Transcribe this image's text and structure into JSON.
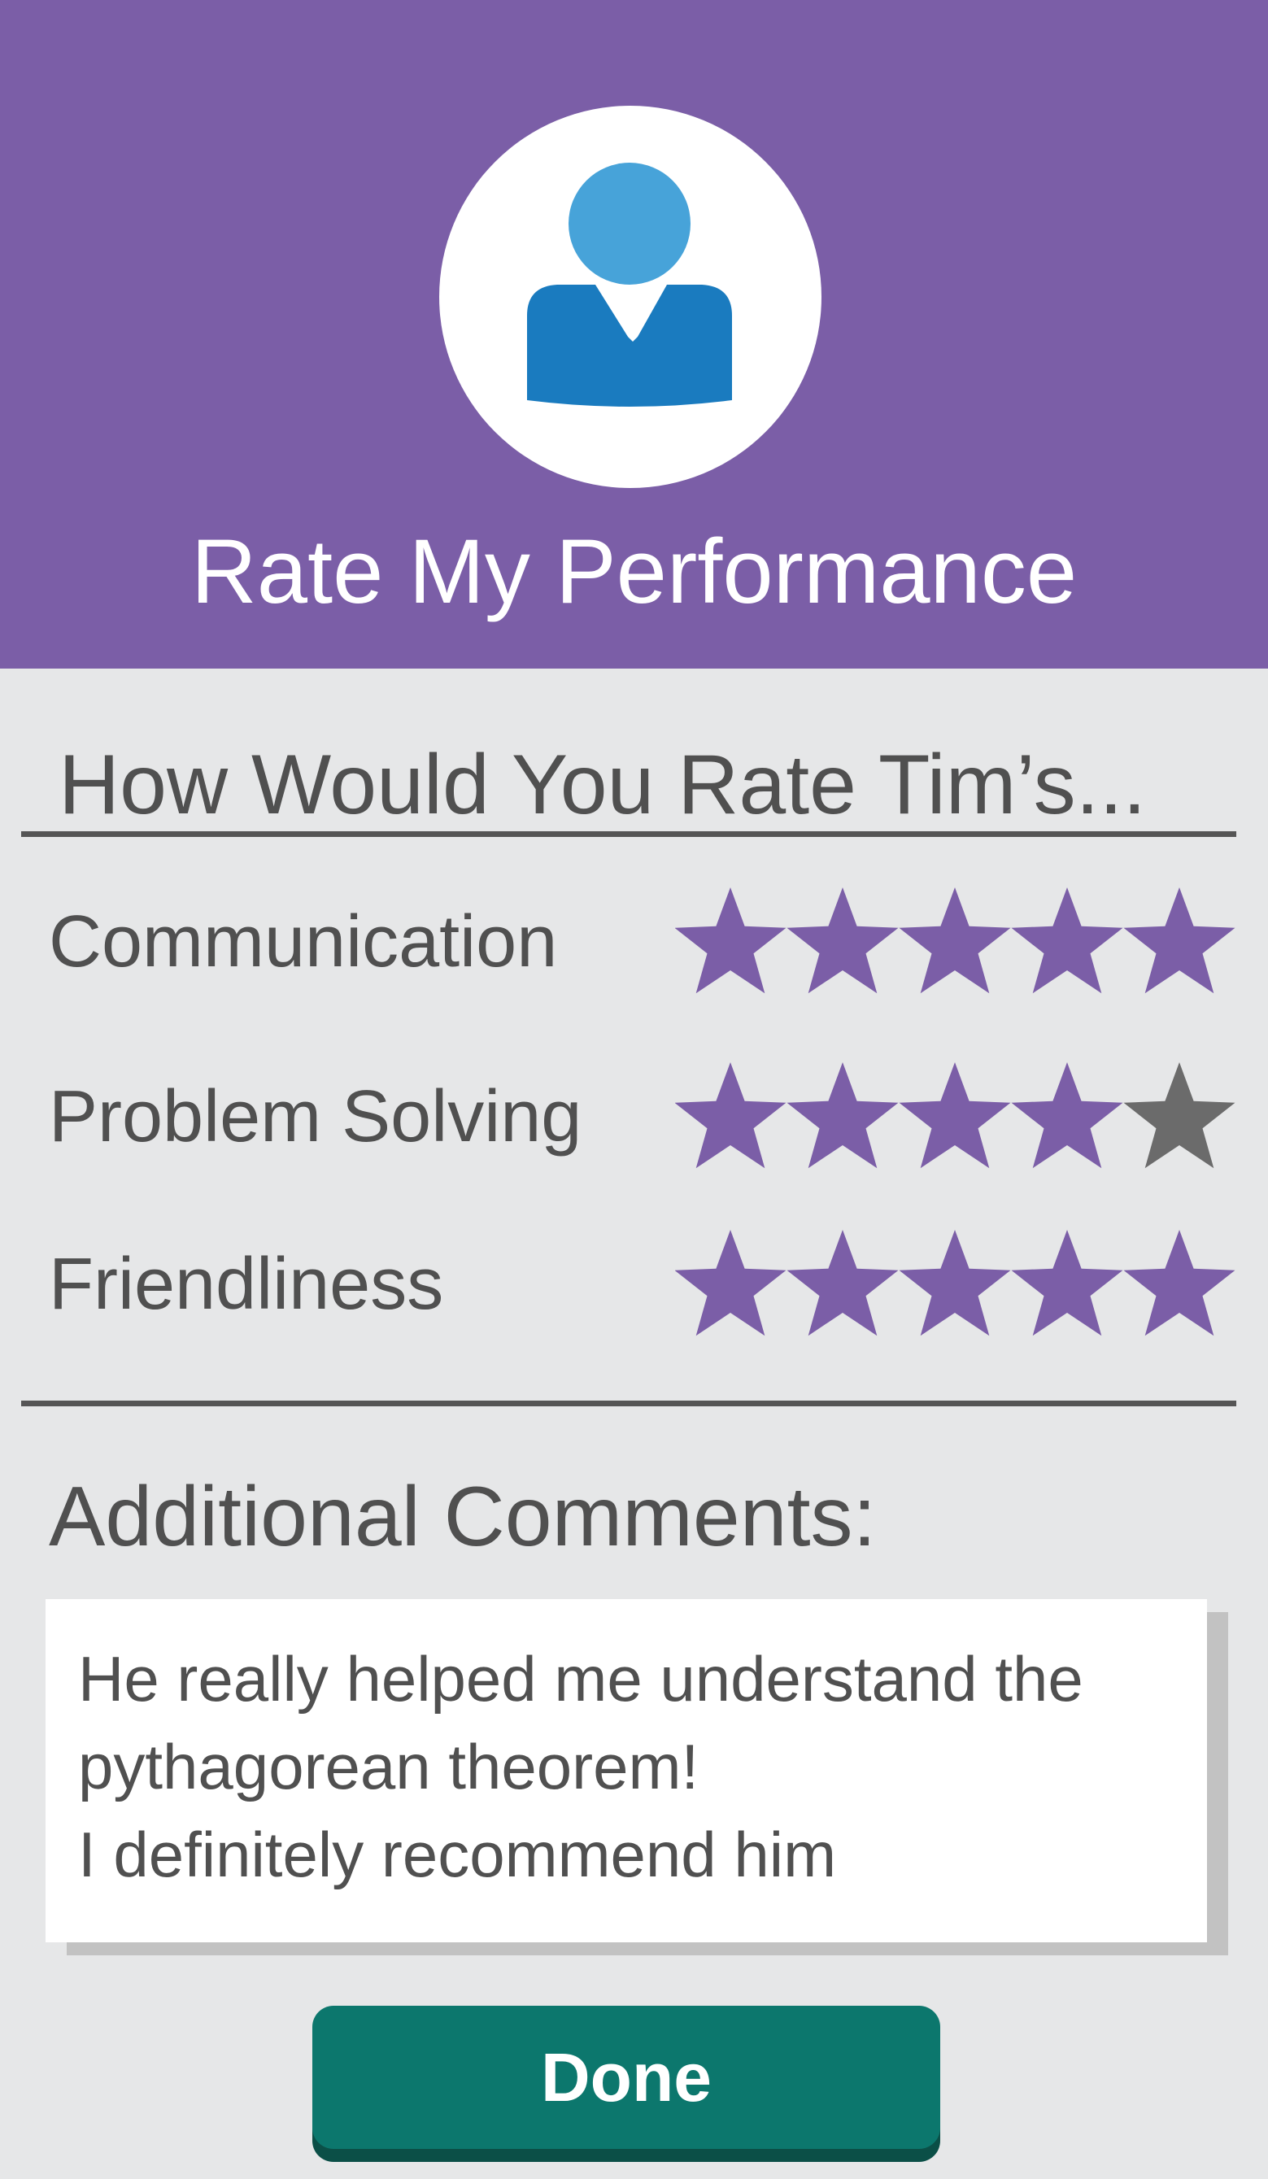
{
  "header": {
    "title": "Rate My Performance",
    "avatar_icon": "user-avatar-icon",
    "background_color": "#7b5ea7"
  },
  "question": "How Would You Rate Tim’s...",
  "ratings": [
    {
      "label": "Communication",
      "value": 5,
      "max": 5
    },
    {
      "label": "Problem Solving",
      "value": 4,
      "max": 5
    },
    {
      "label": "Friendliness",
      "value": 5,
      "max": 5
    }
  ],
  "star_icon": "star-icon",
  "colors": {
    "star_filled": "#7b5ea7",
    "star_empty": "#6b6b6b",
    "done_button": "#0c776d"
  },
  "comments": {
    "heading": "Additional Comments:",
    "lines": [
      "He really helped me understand the",
      "pythagorean theorem!",
      "I definitely recommend him"
    ]
  },
  "done_label": "Done"
}
